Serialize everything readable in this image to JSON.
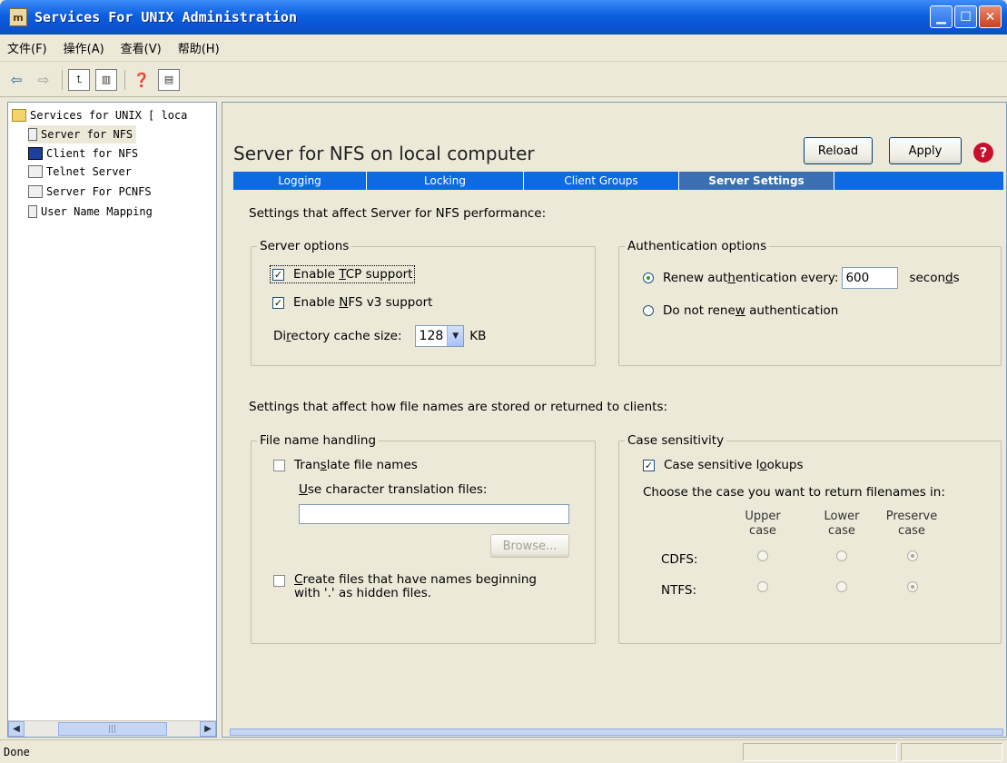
{
  "window": {
    "title": "Services For UNIX Administration",
    "app_icon_glyph": "m"
  },
  "menu": [
    "文件(F)",
    "操作(A)",
    "查看(V)",
    "帮助(H)"
  ],
  "toolbar": {
    "buttons": [
      "back-arrow-icon",
      "forward-arrow-icon",
      "up-folder-icon",
      "show-tree-icon",
      "help-icon",
      "console-icon"
    ]
  },
  "tree": {
    "root": "Services for UNIX [ loca",
    "items": [
      "Server for NFS",
      "Client for NFS",
      "Telnet Server",
      "Server For PCNFS",
      "User Name Mapping"
    ]
  },
  "pane": {
    "title": "Server for NFS on local computer",
    "reload_label": "Reload",
    "apply_label": "Apply",
    "tabs": [
      "Logging",
      "Locking",
      "Client Groups",
      "Server Settings"
    ],
    "active_tab": "Server Settings",
    "perf_heading": "Settings that affect Server for NFS performance:",
    "server_options": {
      "legend": "Server options",
      "tcp_label": "Enable TCP support",
      "tcp_checked": true,
      "nfsv3_label": "Enable NFS v3 support",
      "nfsv3_checked": true,
      "cache_label": "Directory cache size:",
      "cache_value": "128",
      "cache_unit": "KB"
    },
    "auth_options": {
      "legend": "Authentication options",
      "renew_label": "Renew authentication every:",
      "renew_value": "600",
      "renew_unit": "seconds",
      "no_renew_label": "Do not renew authentication"
    },
    "names_heading": "Settings that affect how file names are stored or returned to clients:",
    "file_name_handling": {
      "legend": "File name handling",
      "translate_label": "Translate file names",
      "use_files_label": "Use character translation files:",
      "browse_label": "Browse...",
      "hidden_label_line1": "Create files that have names beginning",
      "hidden_label_line2": "with '.' as hidden files."
    },
    "case_sensitivity": {
      "legend": "Case sensitivity",
      "lookups_label": "Case sensitive lookups",
      "choose_label": "Choose the case you want to return filenames in:",
      "columns": [
        {
          "line1": "Upper",
          "line2": "case"
        },
        {
          "line1": "Lower",
          "line2": "case"
        },
        {
          "line1": "Preserve",
          "line2": "case"
        }
      ],
      "rows": [
        "CDFS:",
        "NTFS:"
      ]
    }
  },
  "status": {
    "text": "Done"
  }
}
